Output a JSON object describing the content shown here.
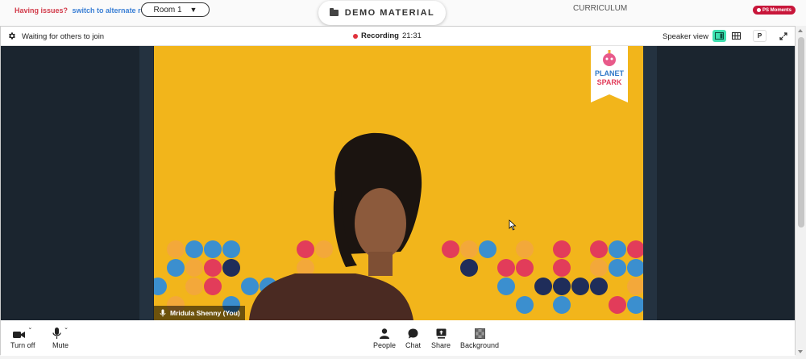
{
  "topbar": {
    "issues_text": "Having issues?",
    "alternate_link": "switch to alternate room",
    "room_selected": "Room 1",
    "demo_material": "DEMO MATERIAL",
    "curriculum": "CURRICULUM",
    "moments_badge": "PS Moments"
  },
  "call": {
    "status": "Waiting for others to join",
    "recording_label": "Recording",
    "recording_time": "21:31",
    "view_label": "Speaker view",
    "p_button": "P"
  },
  "video": {
    "participant_name": "Mridula Shenny (You)",
    "logo_text": [
      "PLANET",
      "SPARK"
    ]
  },
  "controls": {
    "turn_off": "Turn off",
    "mute": "Mute",
    "people": "People",
    "chat": "Chat",
    "share": "Share",
    "background": "Background"
  },
  "colors": {
    "accent_teal": "#3ee0b0",
    "recording_red": "#e0323c",
    "video_bg": "#f2b51b",
    "dot_red": "#e23c5a",
    "dot_blue": "#3b8fcf",
    "dot_navy": "#1f2d5a"
  }
}
